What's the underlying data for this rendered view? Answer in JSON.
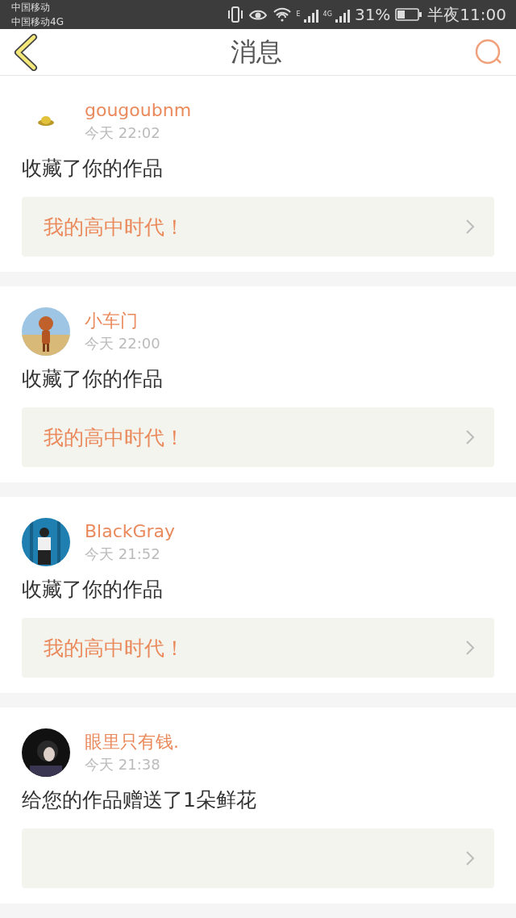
{
  "status_bar": {
    "carriers": [
      "中国移动",
      "中国移动4G"
    ],
    "signal_labels": [
      "E",
      "4G"
    ],
    "battery": "31%",
    "time": "半夜11:00"
  },
  "header": {
    "title": "消息"
  },
  "messages": [
    {
      "name": "gougoubnm",
      "time": "今天 22:02",
      "action": "收藏了你的作品",
      "work": "我的高中时代！"
    },
    {
      "name": "小车门",
      "time": "今天 22:00",
      "action": "收藏了你的作品",
      "work": "我的高中时代！"
    },
    {
      "name": "BlackGray",
      "time": "今天 21:52",
      "action": "收藏了你的作品",
      "work": "我的高中时代！"
    },
    {
      "name": "眼里只有钱.",
      "time": "今天 21:38",
      "action": "给您的作品赠送了1朵鲜花"
    }
  ]
}
